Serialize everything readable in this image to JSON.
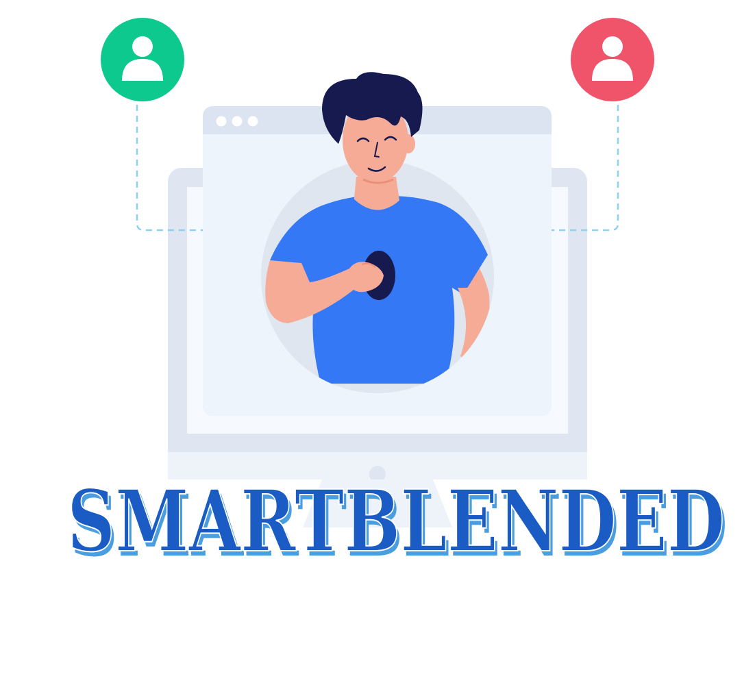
{
  "brand": {
    "wordmark": "SMARTBLENDED"
  },
  "colors": {
    "left_avatar": "#0dc98d",
    "right_avatar": "#f0546a",
    "wordmark_dark": "#1a5cc4",
    "wordmark_light": "#4a9ee0",
    "shirt": "#3478f6",
    "hair": "#161a4e",
    "skin": "#f5ab96",
    "monitor_frame": "#dfe6f1",
    "monitor_screen": "#f2f6fc",
    "connector_dash": "#8dd0f2"
  },
  "icons": {
    "left_user": "user-avatar-icon",
    "right_user": "user-avatar-icon"
  }
}
